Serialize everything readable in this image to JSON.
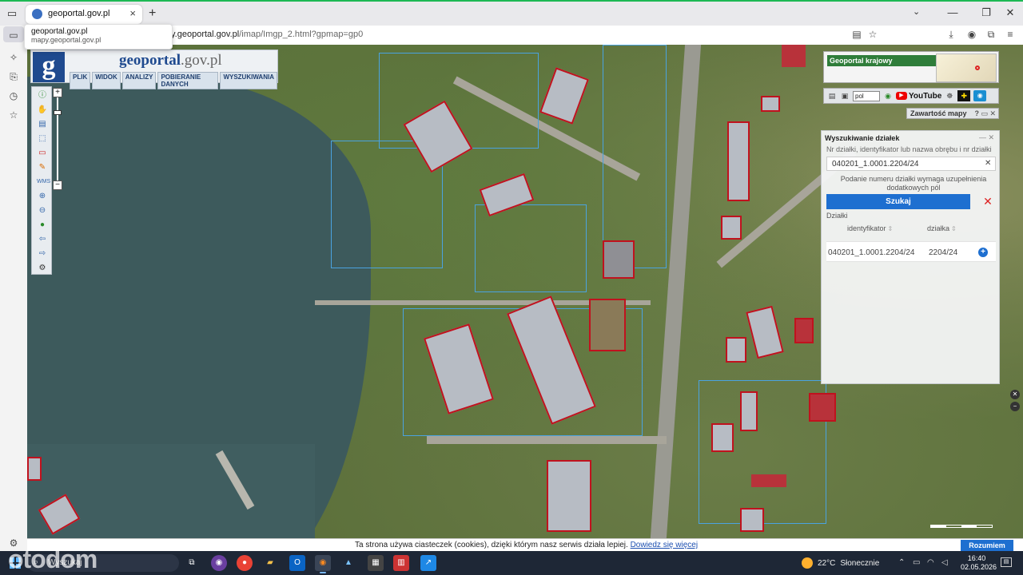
{
  "browser": {
    "tab_title": "geoportal.gov.pl",
    "tooltip_title": "geoportal.gov.pl",
    "tooltip_url": "mapy.geoportal.gov.pl",
    "url_host": "y.geoportal.gov.pl",
    "url_path": "/imap/Imgp_2.html?gpmap=gp0"
  },
  "geoportal": {
    "logo_letter": "g",
    "title_main": "geoportal",
    "title_domain": ".gov.pl",
    "menu": [
      "PLIK",
      "WIDOK",
      "ANALIZY",
      "POBIERANIE DANYCH",
      "WYSZUKIWANIA"
    ],
    "national_label": "Geoportal krajowy",
    "lang_value": "pol",
    "youtube_label": "YouTube",
    "content_panel_label": "Zawartość mapy",
    "content_panel_ctrls": "? ▭ ✕"
  },
  "search": {
    "title": "Wyszukiwanie działek",
    "hint": "Nr działki, identyfikator lub nazwa obrębu i nr działki",
    "input_value": "040201_1.0001.2204/24",
    "note": "Podanie numeru działki wymaga uzupełnienia dodatkowych pól",
    "search_button": "Szukaj",
    "results_label": "Działki",
    "col_identifier": "identyfikator",
    "col_parcel": "działka",
    "row_identifier": "040201_1.0001.2204/24",
    "row_parcel": "2204/24"
  },
  "cookie": {
    "message": "Ta strona używa ciasteczek (cookies), dzięki którym nasz serwis działa lepiej.",
    "link": "Dowiedz się więcej",
    "button": "Rozumiem"
  },
  "watermark": "otodom",
  "taskbar": {
    "search_text": "Wyszukaj",
    "weather_temp": "22°C",
    "weather_desc": "Słonecznie",
    "time": "16:40",
    "date": "02.05.2026"
  }
}
